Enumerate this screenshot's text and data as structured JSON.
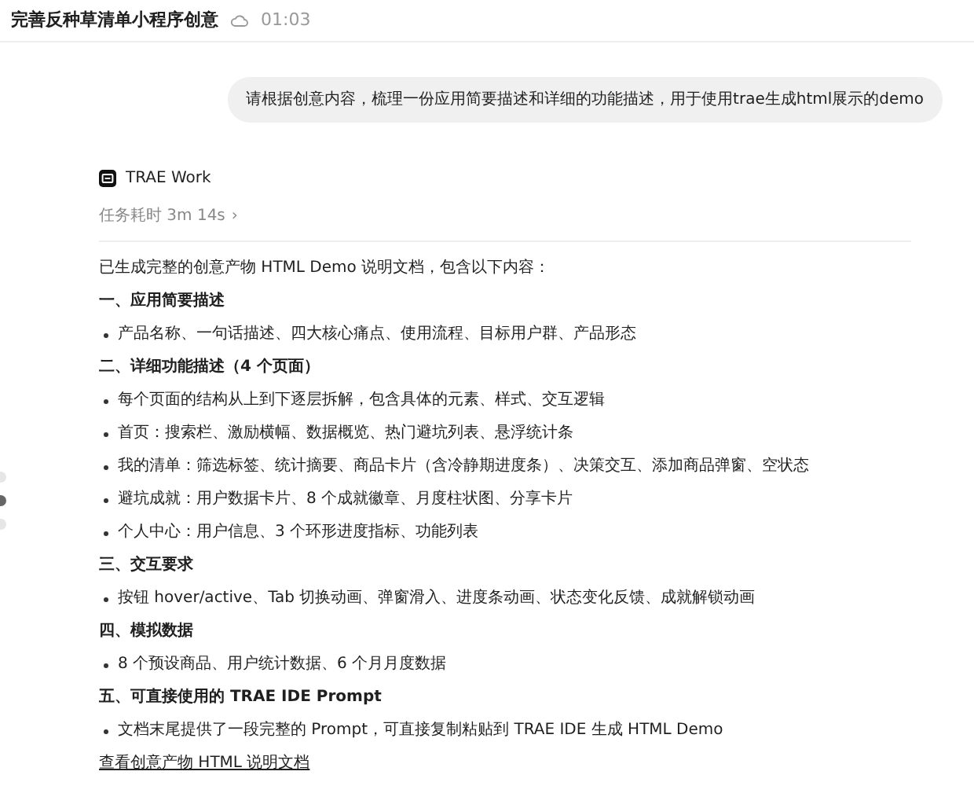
{
  "header": {
    "title": "完善反种草清单小程序创意",
    "time": "01:03"
  },
  "user_message": "请根据创意内容，梳理一份应用简要描述和详细的功能描述，用于使用trae生成html展示的demo",
  "agent": {
    "name": "TRAE Work",
    "duration": "任务耗时 3m 14s",
    "chevron": "›"
  },
  "blocks": [
    {
      "kind": "paragraph",
      "text": "已生成完整的创意产物 HTML Demo 说明文档，包含以下内容："
    },
    {
      "kind": "heading",
      "text": "一、应用简要描述"
    },
    {
      "kind": "bullet",
      "text": "产品名称、一句话描述、四大核心痛点、使用流程、目标用户群、产品形态"
    },
    {
      "kind": "heading",
      "text": "二、详细功能描述（4 个页面）"
    },
    {
      "kind": "bullet",
      "text": "每个页面的结构从上到下逐层拆解，包含具体的元素、样式、交互逻辑"
    },
    {
      "kind": "bullet",
      "text": "首页：搜索栏、激励横幅、数据概览、热门避坑列表、悬浮统计条"
    },
    {
      "kind": "bullet",
      "text": "我的清单：筛选标签、统计摘要、商品卡片（含冷静期进度条）、决策交互、添加商品弹窗、空状态"
    },
    {
      "kind": "bullet",
      "text": "避坑成就：用户数据卡片、8 个成就徽章、月度柱状图、分享卡片"
    },
    {
      "kind": "bullet",
      "text": "个人中心：用户信息、3 个环形进度指标、功能列表"
    },
    {
      "kind": "heading",
      "text": "三、交互要求"
    },
    {
      "kind": "bullet",
      "text": "按钮 hover/active、Tab 切换动画、弹窗滑入、进度条动画、状态变化反馈、成就解锁动画"
    },
    {
      "kind": "heading",
      "text": "四、模拟数据"
    },
    {
      "kind": "bullet",
      "text": "8 个预设商品、用户统计数据、6 个月月度数据"
    },
    {
      "kind": "heading",
      "text": "五、可直接使用的 TRAE IDE Prompt"
    },
    {
      "kind": "bullet",
      "text": "文档末尾提供了一段完整的 Prompt，可直接复制粘贴到 TRAE IDE 生成 HTML Demo"
    },
    {
      "kind": "link",
      "text": "查看创意产物 HTML 说明文档"
    }
  ]
}
